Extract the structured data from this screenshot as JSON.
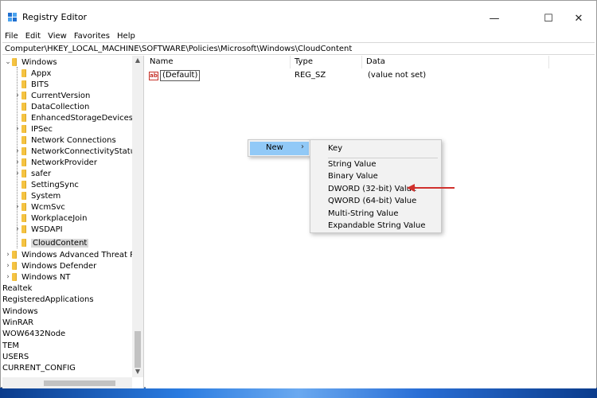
{
  "window": {
    "title": "Registry Editor",
    "controls": {
      "minimize": "—",
      "maximize": "☐",
      "close": "✕"
    }
  },
  "menu": [
    "File",
    "Edit",
    "View",
    "Favorites",
    "Help"
  ],
  "address": "Computer\\HKEY_LOCAL_MACHINE\\SOFTWARE\\Policies\\Microsoft\\Windows\\CloudContent",
  "tree": {
    "root": "Windows",
    "children": [
      "Appx",
      "BITS",
      "CurrentVersion",
      "DataCollection",
      "EnhancedStorageDevices",
      "IPSec",
      "Network Connections",
      "NetworkConnectivityStatusIn",
      "NetworkProvider",
      "safer",
      "SettingSync",
      "System",
      "WcmSvc",
      "WorkplaceJoin",
      "WSDAPI",
      "CloudContent"
    ],
    "siblings": [
      "Windows Advanced Threat Prote",
      "Windows Defender",
      "Windows NT"
    ],
    "other": [
      "Realtek",
      "RegisteredApplications",
      "Windows",
      "WinRAR",
      "WOW6432Node",
      "TEM",
      "USERS",
      "CURRENT_CONFIG"
    ]
  },
  "list": {
    "headers": {
      "name": "Name",
      "type": "Type",
      "data": "Data"
    },
    "rows": [
      {
        "icon": "ab",
        "name": "(Default)",
        "type": "REG_SZ",
        "data": "(value not set)"
      }
    ]
  },
  "context_menu": {
    "new_label": "New",
    "arrow": "›",
    "submenu": [
      "Key",
      "String Value",
      "Binary Value",
      "DWORD (32-bit) Value",
      "QWORD (64-bit) Value",
      "Multi-String Value",
      "Expandable String Value"
    ]
  },
  "colors": {
    "highlight": "#91c9f7",
    "arrow": "#d0312d",
    "folder": "#f5c342"
  }
}
